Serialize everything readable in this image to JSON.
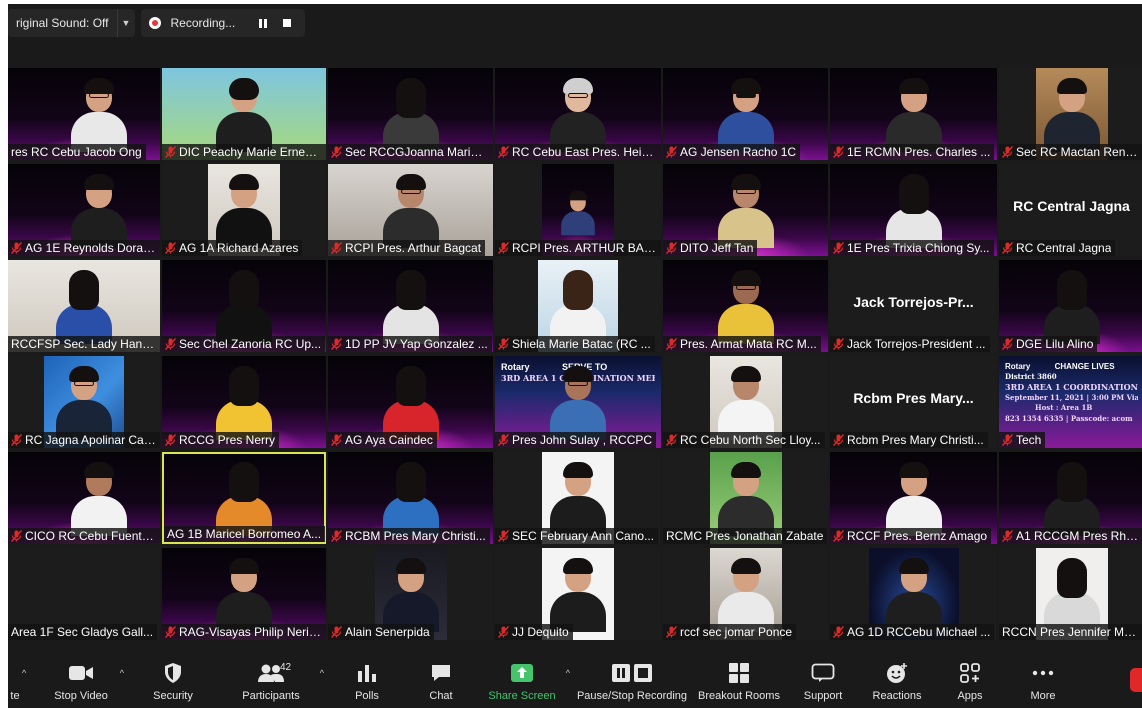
{
  "top_bar": {
    "sound_label": "riginal Sound: Off",
    "recording_label": "Recording..."
  },
  "tiles": [
    {
      "name": "res RC Cebu Jacob Ong"
    },
    {
      "name": "DIC Peachy Marie Ernest..."
    },
    {
      "name": "Sec RCCGJoanna Marie ..."
    },
    {
      "name": "RC Cebu East Pres. Hein..."
    },
    {
      "name": "AG Jensen Racho 1C"
    },
    {
      "name": "1E RCMN Pres. Charles ..."
    },
    {
      "name": "Sec RC Mactan Rene Ba"
    },
    {
      "name": "AG 1E Reynolds Dorado"
    },
    {
      "name": "AG 1A Richard Azares"
    },
    {
      "name": "RCPI Pres. Arthur Bagcat"
    },
    {
      "name": "RCPI Pres. ARTHUR BAG..."
    },
    {
      "name": "DITO Jeff Tan"
    },
    {
      "name": "1E Pres Trixia Chiong Sy..."
    },
    {
      "name": "RC Central Jagna",
      "display_name": "RC Central Jagna"
    },
    {
      "name": "RCCFSP Sec. Lady Hann..."
    },
    {
      "name": "Sec Chel Zanoria RC Up..."
    },
    {
      "name": "1D PP JV Yap Gonzalez ..."
    },
    {
      "name": "Shiela Marie Batac (RC ..."
    },
    {
      "name": "Pres. Armat Mata RC M..."
    },
    {
      "name": "Jack Torrejos-President ...",
      "display_name": "Jack Torrejos-Pr..."
    },
    {
      "name": "DGE Lilu Alino"
    },
    {
      "name": "RC Jagna Apolinar Cade..."
    },
    {
      "name": "RCCG Pres Nerry"
    },
    {
      "name": "AG Aya Caindec"
    },
    {
      "name": "Pres John Sulay , RCCPC"
    },
    {
      "name": "RC Cebu North Sec Lloy..."
    },
    {
      "name": "Rcbm Pres Mary Christi...",
      "display_name": "Rcbm Pres Mary..."
    },
    {
      "name": "Tech"
    },
    {
      "name": "CICO RC Cebu Fuente T..."
    },
    {
      "name": "AG 1B Maricel Borromeo A..."
    },
    {
      "name": "RCBM Pres Mary Christi..."
    },
    {
      "name": "SEC February Ann Cano..."
    },
    {
      "name": "RCMC Pres Jonathan Zabate"
    },
    {
      "name": "RCCF Pres. Bernz Amago"
    },
    {
      "name": "A1 RCCGM Pres Rhea M"
    },
    {
      "name": "Area 1F Sec Gladys Gall..."
    },
    {
      "name": "RAG-Visayas Philip Neri ..."
    },
    {
      "name": "Alain Senerpida"
    },
    {
      "name": "JJ Dequito"
    },
    {
      "name": "rccf sec jomar Ponce"
    },
    {
      "name": "AG 1D RCCebu Michael ..."
    },
    {
      "name": "RCCN Pres Jennifer Moren"
    }
  ],
  "banners": {
    "serve": "SERVE TO",
    "change": "CHANGE LIVES",
    "rotary": "Rotary",
    "district": "District 3860",
    "coordination_pres_john": "3RD AREA 1 COORDINATION MEETING",
    "via_zoom": "ZOOM",
    "tech_title": "3RD AREA 1 COORDINATION MEETI",
    "tech_date": "September 11, 2021 | 3:00 PM Via ZOOM",
    "tech_host": "Host : Area 1B",
    "tech_code": "823 1354 6335 | Passcode: acom"
  },
  "toolbar": {
    "leave_fragment": "te",
    "stop_video": "Stop Video",
    "security": "Security",
    "participants": "Participants",
    "participants_count": "42",
    "polls": "Polls",
    "chat": "Chat",
    "share_screen": "Share Screen",
    "pause_stop_recording": "Pause/Stop Recording",
    "breakout_rooms": "Breakout Rooms",
    "support": "Support",
    "reactions": "Reactions",
    "apps": "Apps",
    "more": "More"
  },
  "colors": {
    "active_speaker": "#d9e552",
    "share_green": "#46c36b",
    "mic_muted_red": "#e02828",
    "meeting_bg": "#1a1a1a"
  }
}
